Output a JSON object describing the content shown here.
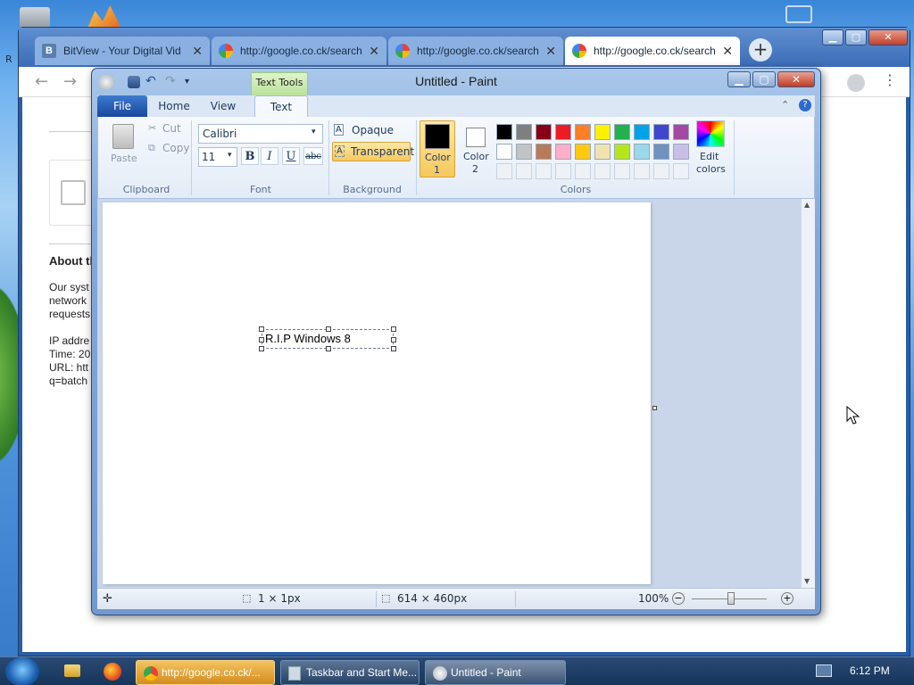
{
  "desktop": {
    "edge_letter": "R"
  },
  "chrome": {
    "tabs": [
      {
        "title": "BitView - Your Digital Vid",
        "icon": "bitview-favicon"
      },
      {
        "title": "http://google.co.ck/search",
        "icon": "google-favicon"
      },
      {
        "title": "http://google.co.ck/search",
        "icon": "google-favicon"
      },
      {
        "title": "http://google.co.ck/search",
        "icon": "google-favicon",
        "active": true
      }
    ],
    "new_tab": "+",
    "page": {
      "heading": "About th",
      "para1": [
        "Our syst",
        "network",
        "requests"
      ],
      "para2": [
        "IP addre",
        "Time: 20",
        "URL: htt",
        "q=batch"
      ]
    }
  },
  "paint": {
    "title": "Untitled - Paint",
    "contextual_tab": "Text Tools",
    "tabs": [
      "File",
      "Home",
      "View",
      "Text"
    ],
    "active_tab": "Text",
    "clipboard": {
      "paste": "Paste",
      "cut": "Cut",
      "copy": "Copy",
      "label": "Clipboard"
    },
    "font": {
      "family": "Calibri",
      "size": "11",
      "bold": "B",
      "italic": "I",
      "underline": "U",
      "strike": "abc",
      "label": "Font"
    },
    "background": {
      "opaque": "Opaque",
      "transparent": "Transparent",
      "selected": "Transparent",
      "label": "Background"
    },
    "colors": {
      "color1_label": [
        "Color",
        "1"
      ],
      "color2_label": [
        "Color",
        "2"
      ],
      "color1": "#000000",
      "color2": "#ffffff",
      "edit_label": [
        "Edit",
        "colors"
      ],
      "label": "Colors",
      "palette_row1": [
        "#000000",
        "#7f7f7f",
        "#880015",
        "#ed1c24",
        "#ff7f27",
        "#fff200",
        "#22b14c",
        "#00a2e8",
        "#3f48cc",
        "#a349a4"
      ],
      "palette_row2": [
        "#ffffff",
        "#c3c3c3",
        "#b97a57",
        "#ffaec9",
        "#ffc90e",
        "#efe4b0",
        "#b5e61d",
        "#99d9ea",
        "#7092be",
        "#c8bfe7"
      ]
    },
    "canvas_text": "R.I.P Windows 8",
    "status": {
      "selection": "1 × 1px",
      "size": "614 × 460px",
      "zoom": "100%"
    }
  },
  "taskbar": {
    "items": [
      {
        "label": "http://google.co.ck/...",
        "icon": "chrome-icon"
      },
      {
        "label": "Taskbar and Start Me...",
        "icon": "properties-icon"
      },
      {
        "label": "Untitled - Paint",
        "icon": "paint-icon"
      }
    ],
    "clock": "6:12 PM"
  }
}
